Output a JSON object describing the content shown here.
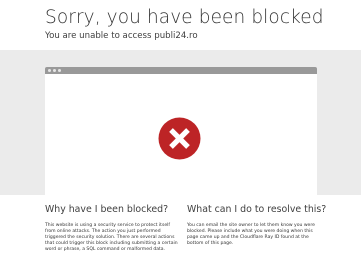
{
  "header": {
    "title": "Sorry, you have been blocked",
    "subtitle": "You are unable to access publi24.ro"
  },
  "icons": {
    "block_icon": "blocked-x-icon",
    "colors": {
      "circle": "#bd2426",
      "cross": "#ffffff",
      "bar": "#999999",
      "band": "#ebebeb"
    }
  },
  "why": {
    "heading": "Why have I been blocked?",
    "body": "This website is using a security service to protect itself from online attacks. The action you just performed triggered the security solution. There are several actions that could trigger this block including submitting a certain word or phrase, a SQL command or malformed data."
  },
  "resolve": {
    "heading": "What can I do to resolve this?",
    "body": "You can email the site owner to let them know you were blocked. Please include what you were doing when this page came up and the Cloudflare Ray ID found at the bottom of this page."
  }
}
